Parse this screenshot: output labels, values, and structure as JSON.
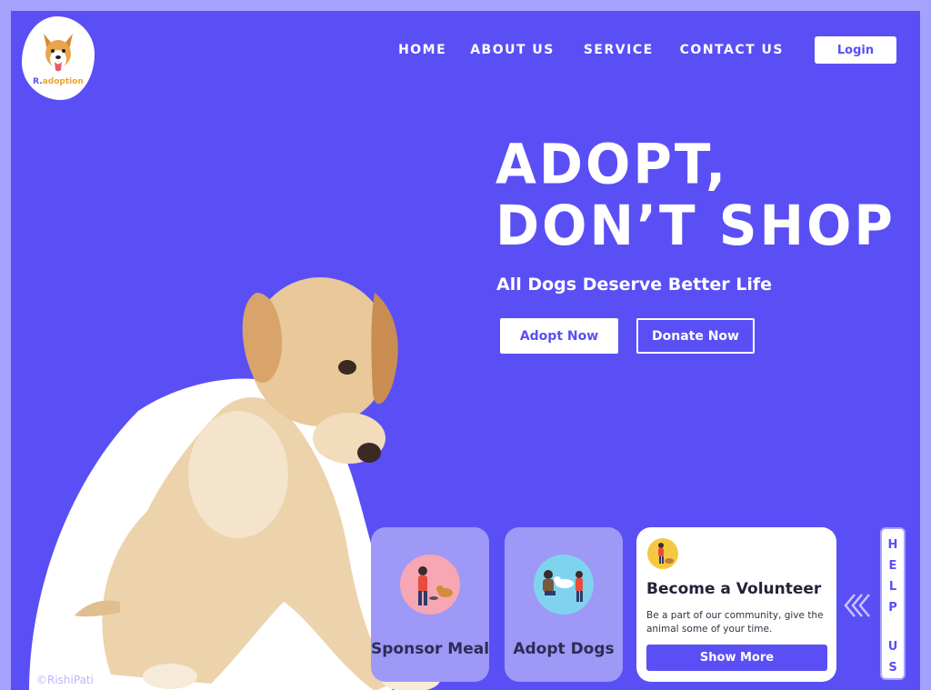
{
  "logo": {
    "text_prefix": "R.",
    "text_main": "adoption"
  },
  "nav": {
    "items": [
      "HOME",
      "ABOUT US",
      "SERVICE",
      "CONTACT US"
    ],
    "login_label": "Login"
  },
  "hero": {
    "title_line1": "ADOPT,",
    "title_line2": "DON’T SHOP",
    "subtitle": "All Dogs Deserve Better Life",
    "adopt_button": "Adopt Now",
    "donate_button": "Donate Now"
  },
  "cards": {
    "sponsor_label": "Sponsor Meal",
    "adopt_dogs_label": "Adopt Dogs",
    "volunteer": {
      "title": "Become a Volunteer",
      "description": "Be a part of our community, give the animal some of your time.",
      "button": "Show More"
    }
  },
  "help_tab": {
    "letters_top": [
      "H",
      "E",
      "L",
      "P"
    ],
    "letters_bottom": [
      "U",
      "S"
    ]
  },
  "copyright": "©RishiPati",
  "colors": {
    "primary": "#5a4ff5",
    "outer": "#a5a2fb",
    "card_light": "#9e98f7",
    "logo_orange": "#e8a62c"
  }
}
